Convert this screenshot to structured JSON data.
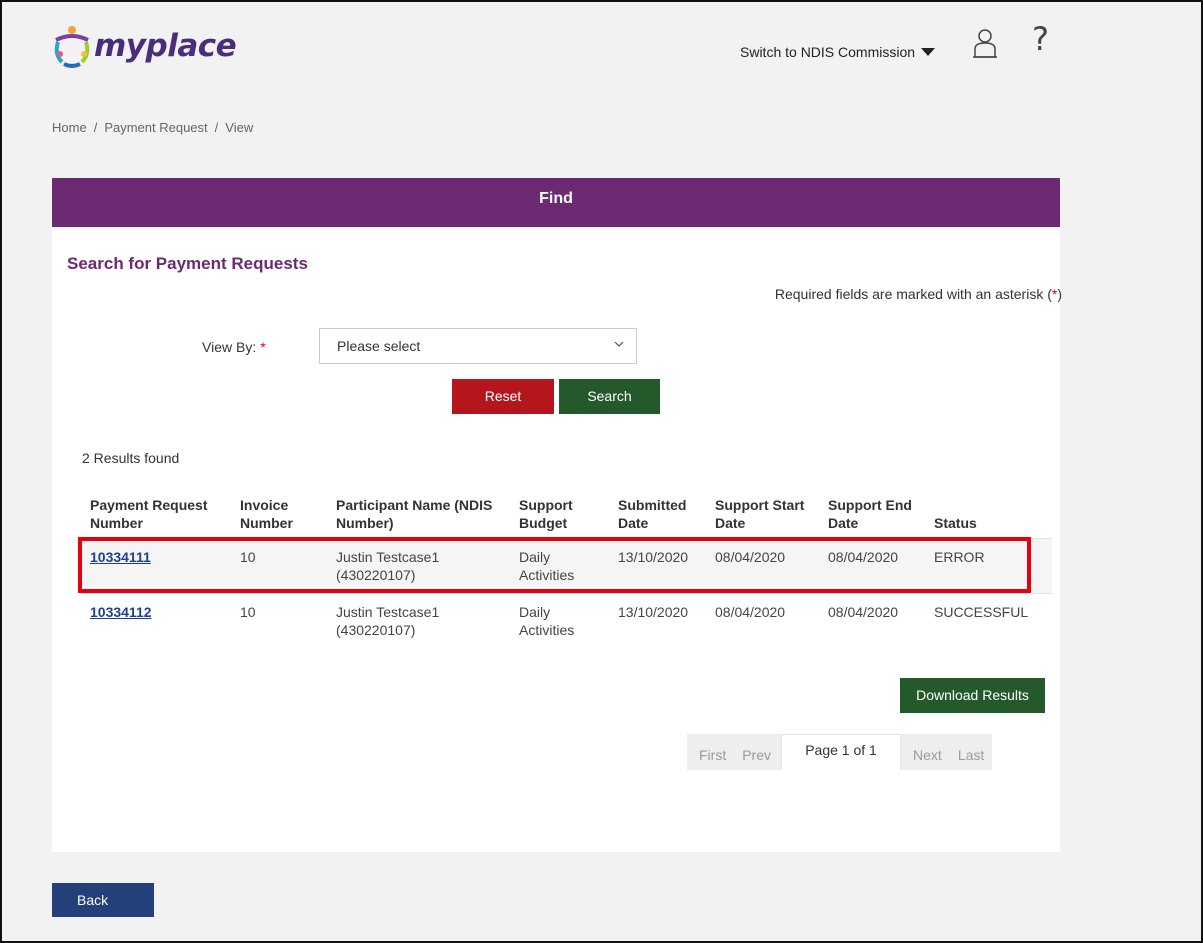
{
  "header": {
    "logo_text": "myplace",
    "switch_label": "Switch to NDIS Commission",
    "help_glyph": "?",
    "user_icon": "user-icon",
    "colors": {
      "brand_purple": "#6b2a72",
      "logo_purple": "#5b3b8c"
    }
  },
  "breadcrumb": {
    "home": "Home",
    "sep": "/",
    "payment_request": "Payment Request",
    "view": "View"
  },
  "panel": {
    "heading": "Find",
    "section_title": "Search for Payment Requests",
    "required_note_prefix": "Required fields are marked with an asterisk (",
    "required_note_asterisk": "*",
    "required_note_suffix": ")"
  },
  "form": {
    "view_by_label": "View By:",
    "view_by_required": "*",
    "view_by_value": "Please select",
    "reset_label": "Reset",
    "search_label": "Search"
  },
  "results": {
    "count_text": "2 Results found",
    "columns": [
      "Payment Request Number",
      "Invoice Number",
      "Participant Name (NDIS Number)",
      "Support Budget",
      "Submitted Date",
      "Support Start Date",
      "Support End Date",
      "Status"
    ],
    "rows": [
      {
        "request_number": "10334111",
        "invoice_number": "10",
        "participant_name": "Justin Testcase1",
        "ndis_number": "(430220107)",
        "budget_line1": "Daily",
        "budget_line2": "Activities",
        "submitted": "13/10/2020",
        "start": "08/04/2020",
        "end": "08/04/2020",
        "status": "ERROR"
      },
      {
        "request_number": "10334112",
        "invoice_number": "10",
        "participant_name": "Justin Testcase1",
        "ndis_number": "(430220107)",
        "budget_line1": "Daily",
        "budget_line2": "Activities",
        "submitted": "13/10/2020",
        "start": "08/04/2020",
        "end": "08/04/2020",
        "status": "SUCCESSFUL"
      }
    ],
    "download_label": "Download Results"
  },
  "pager": {
    "first": "First",
    "prev": "Prev",
    "page_of": "Page 1 of 1",
    "next": "Next",
    "last": "Last"
  },
  "footer": {
    "back_label": "Back"
  }
}
